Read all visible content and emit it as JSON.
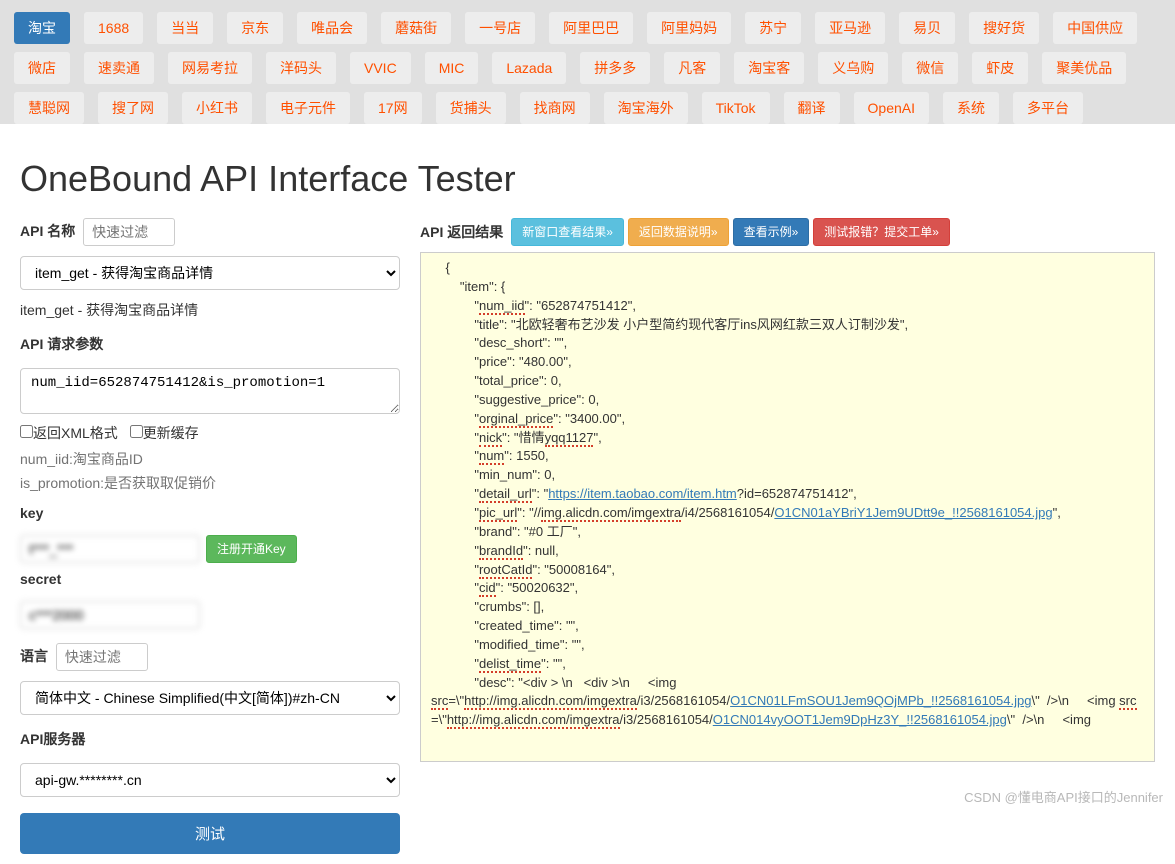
{
  "tabs": [
    {
      "label": "淘宝",
      "active": true
    },
    {
      "label": "1688"
    },
    {
      "label": "当当"
    },
    {
      "label": "京东"
    },
    {
      "label": "唯品会"
    },
    {
      "label": "蘑菇街"
    },
    {
      "label": "一号店"
    },
    {
      "label": "阿里巴巴"
    },
    {
      "label": "阿里妈妈"
    },
    {
      "label": "苏宁"
    },
    {
      "label": "亚马逊"
    },
    {
      "label": "易贝"
    },
    {
      "label": "搜好货"
    },
    {
      "label": "中国供应"
    },
    {
      "label": "微店"
    },
    {
      "label": "速卖通"
    },
    {
      "label": "网易考拉"
    },
    {
      "label": "洋码头"
    },
    {
      "label": "VVIC"
    },
    {
      "label": "MIC"
    },
    {
      "label": "Lazada"
    },
    {
      "label": "拼多多"
    },
    {
      "label": "凡客"
    },
    {
      "label": "淘宝客"
    },
    {
      "label": "义乌购"
    },
    {
      "label": "微信"
    },
    {
      "label": "虾皮"
    },
    {
      "label": "聚美优品"
    },
    {
      "label": "慧聪网"
    },
    {
      "label": "搜了网"
    },
    {
      "label": "小红书"
    },
    {
      "label": "电子元件"
    },
    {
      "label": "17网"
    },
    {
      "label": "货捕头"
    },
    {
      "label": "找商网"
    },
    {
      "label": "淘宝海外"
    },
    {
      "label": "TikTok"
    },
    {
      "label": "翻译"
    },
    {
      "label": "OpenAI"
    },
    {
      "label": "系统"
    },
    {
      "label": "多平台"
    }
  ],
  "page_title": "OneBound API Interface Tester",
  "left": {
    "api_name_label": "API 名称",
    "api_name_filter_placeholder": "快速过滤",
    "api_name_selected": "item_get - 获得淘宝商品详情",
    "api_name_desc": "item_get - 获得淘宝商品详情",
    "params_label": "API 请求参数",
    "params_value": "num_iid=652874751412&is_promotion=1",
    "xml_label": "返回XML格式",
    "cache_label": "更新缓存",
    "params_help1": "num_iid:淘宝商品ID",
    "params_help2": "is_promotion:是否获取取促销价",
    "key_label": "key",
    "key_value": "t***_***",
    "key_btn": "注册开通Key",
    "secret_label": "secret",
    "secret_value": "c***2000",
    "lang_label": "语言",
    "lang_filter_placeholder": "快速过滤",
    "lang_selected": "简体中文 - Chinese Simplified(中文[简体])#zh-CN",
    "server_label": "API服务器",
    "server_selected": "api-gw.********.cn",
    "test_btn": "测试"
  },
  "result": {
    "label": "API 返回结果",
    "btn_new_window": "新窗口查看结果»",
    "btn_data_desc": "返回数据说明»",
    "btn_example": "查看示例»",
    "btn_report": "测试报错？提交工单»",
    "json": {
      "item_open": "\"item\": {",
      "num_iid_k": "num_iid",
      "num_iid_v": "\"652874751412\",",
      "title_line": "\"title\": \"北欧轻奢布艺沙发 小户型简约现代客厅ins风网红款三双人订制沙发\",",
      "desc_short_line": "\"desc_short\": \"\",",
      "price_line": "\"price\": \"480.00\",",
      "total_price_line": "\"total_price\": 0,",
      "suggestive_price_line": "\"suggestive_price\": 0,",
      "orginal_price_k": "orginal_price",
      "orginal_price_v": ": \"3400.00\",",
      "nick_k1": "nick",
      "nick_v1": "\": \"惜情",
      "nick_k2": "yqq1127",
      "nick_v2": "\",",
      "num_k": "num",
      "num_v": ": 1550,",
      "min_num_line": "\"min_num\": 0,",
      "detail_url_k": "detail_url",
      "detail_url_v1": "\": \"",
      "detail_url_link": "https://item.taobao.com/item.htm",
      "detail_url_v2": "?id=652874751412\",",
      "pic_url_k": "pic_url",
      "pic_url_v1": "\": \"//",
      "pic_url_host": "img.alicdn.com/imgextra",
      "pic_url_v2": "/i4/2568161054/",
      "pic_url_file": "O1CN01aYBriY1Jem9UDtt9e_!!2568161054.jpg",
      "pic_url_v3": "\",",
      "brand_line": "\"brand\": \"#0 工厂\",",
      "brandId_k": "brandId",
      "brandId_v": ": null,",
      "rootCatId_k": "rootCatId",
      "rootCatId_v": ": \"50008164\",",
      "cid_k": "cid",
      "cid_v": ": \"50020632\",",
      "crumbs_line": "\"crumbs\": [],",
      "created_time_line": "\"created_time\": \"\",",
      "modified_time_line": "\"modified_time\": \"\",",
      "delist_k": "delist_time",
      "delist_v": ": \"\",",
      "desc_open": "\"desc\": \"<div > \\n   <div >\\n     <img",
      "src_k": "src",
      "src_v1": "=\\\"",
      "src_url1_host": "http://img.alicdn.com/imgextra",
      "src_url1_path": "/i3/2568161054/",
      "src_url1_file": "O1CN01LFmSOU1Jem9QOjMPb_!!2568161054.jpg",
      "src_v2": "\\\"  />\\n     <img ",
      "src_url2_host": "http://img.alicdn.com/imgextra",
      "src_url2_path": "/i3/2568161054/",
      "src_url2_file": "O1CN014vyOOT1Jem9DpHz3Y_!!2568161054.jpg",
      "src_v3": "\\\"  />\\n     <img"
    }
  },
  "watermark": "CSDN @懂电商API接口的Jennifer"
}
